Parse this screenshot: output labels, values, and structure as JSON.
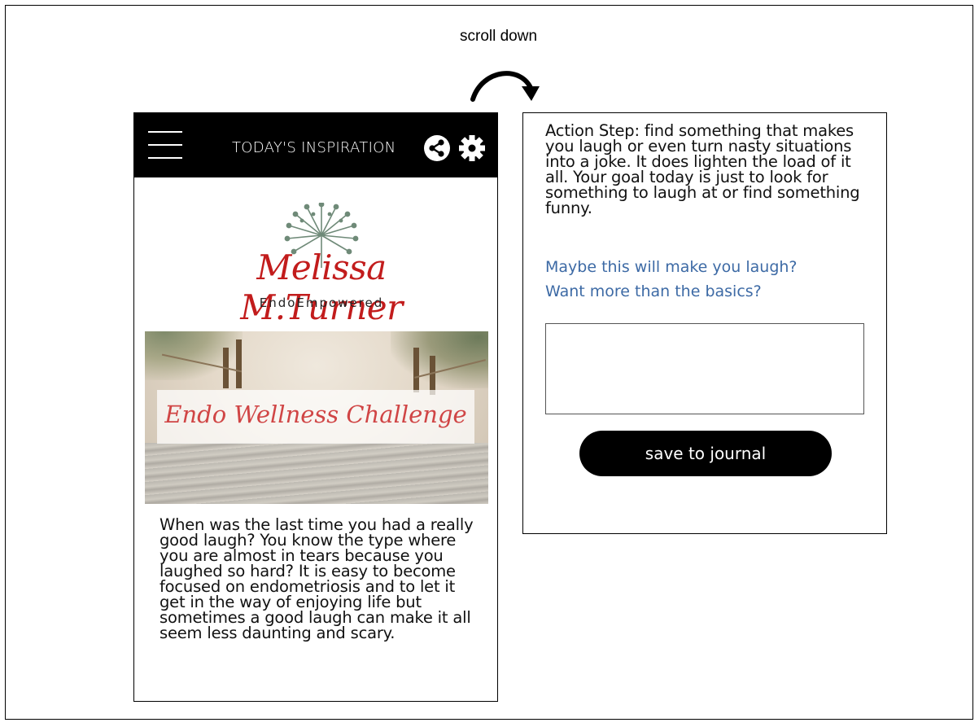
{
  "annotation": {
    "scroll_label": "scroll down"
  },
  "app_bar": {
    "title": "TODAY'S INSPIRATION",
    "icons": [
      "hamburger-menu-icon",
      "share-icon",
      "gear-icon"
    ]
  },
  "logo": {
    "name": "Melissa M.Turner",
    "tagline": "EndoEmpowered",
    "brand_color": "#c21c1c",
    "flower_color": "#6f8a78"
  },
  "banner": {
    "text": "Endo Wellness Challenge",
    "text_color": "#d04545"
  },
  "content": {
    "intro": "When was the last time you had a really good laugh? You know the type where you are almost in tears because you laughed so hard? It is easy to become focused on endometriosis and to let it get in the way of enjoying life but sometimes a good laugh can make it all seem less daunting and scary.",
    "action_step": "Action Step: find something that makes you laugh or even turn nasty situations into a joke. It does lighten the load of it all. Your goal today is just to look for something to laugh at or find something funny.",
    "links": [
      "Maybe this will make you laugh?",
      "Want more than the basics?"
    ],
    "link_color": "#3d6aa5"
  },
  "journal": {
    "value": "",
    "save_label": "save to journal"
  }
}
